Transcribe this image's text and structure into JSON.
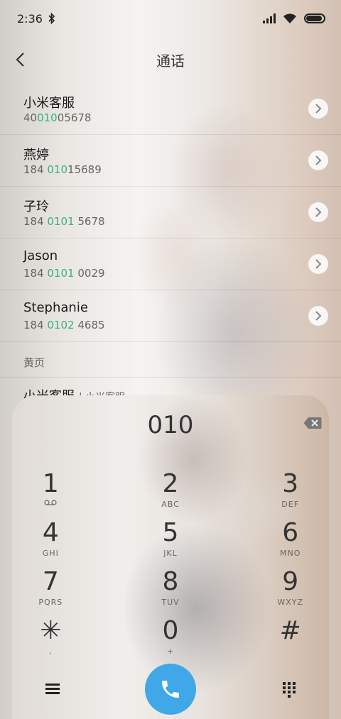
{
  "status": {
    "time": "2:36",
    "bluetooth_icon": "bluetooth-icon"
  },
  "header": {
    "title": "通话",
    "back_icon": "back-chevron-icon"
  },
  "contacts": [
    {
      "name": "小米客服",
      "num_pre": "40",
      "num_hl": "010",
      "num_post": "05678"
    },
    {
      "name": "燕婷",
      "num_pre": "184 ",
      "num_hl": "010",
      "num_post": "15689"
    },
    {
      "name": "子玲",
      "num_pre": "184 ",
      "num_hl": "0101",
      "num_post": " 5678"
    },
    {
      "name": "Jason",
      "num_pre": "184 ",
      "num_hl": "0101",
      "num_post": " 0029"
    },
    {
      "name": "Stephanie",
      "num_pre": "184 ",
      "num_hl": "0102",
      "num_post": " 4685"
    }
  ],
  "yellow_pages": {
    "section_label": "黄页",
    "partial_name": "小米客服",
    "partial_sub": "| 小米客服"
  },
  "dialpad": {
    "input": "010",
    "keys": [
      {
        "digit": "1",
        "letters": "⌁"
      },
      {
        "digit": "2",
        "letters": "ABC"
      },
      {
        "digit": "3",
        "letters": "DEF"
      },
      {
        "digit": "4",
        "letters": "GHI"
      },
      {
        "digit": "5",
        "letters": "JKL"
      },
      {
        "digit": "6",
        "letters": "MNO"
      },
      {
        "digit": "7",
        "letters": "PQRS"
      },
      {
        "digit": "8",
        "letters": "TUV"
      },
      {
        "digit": "9",
        "letters": "WXYZ"
      },
      {
        "digit": "✳",
        "letters": ","
      },
      {
        "digit": "0",
        "letters": "+"
      },
      {
        "digit": "#",
        "letters": ""
      }
    ]
  },
  "colors": {
    "highlight": "#3bb17a",
    "call_button": "#40a8e8"
  }
}
